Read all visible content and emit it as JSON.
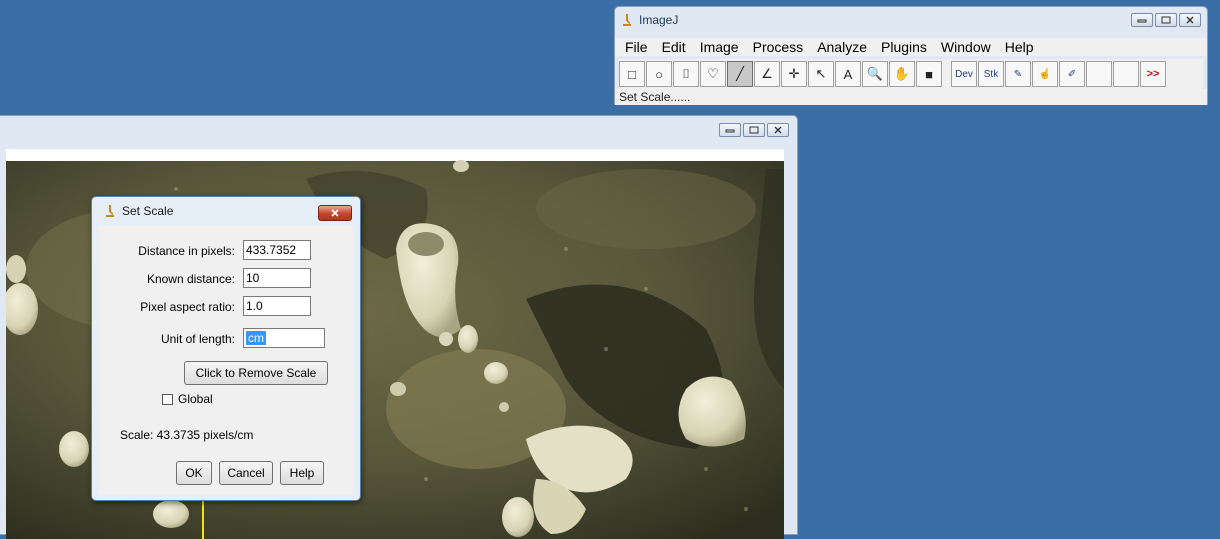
{
  "imagej": {
    "title": "ImageJ",
    "menus": [
      "File",
      "Edit",
      "Image",
      "Process",
      "Analyze",
      "Plugins",
      "Window",
      "Help"
    ],
    "tools": [
      {
        "name": "rectangle-tool-icon",
        "glyph": "□"
      },
      {
        "name": "oval-tool-icon",
        "glyph": "○"
      },
      {
        "name": "polygon-tool-icon",
        "glyph": "⌷"
      },
      {
        "name": "freehand-tool-icon",
        "glyph": "♡"
      },
      {
        "name": "line-tool-icon",
        "glyph": "╱",
        "active": true
      },
      {
        "name": "angle-tool-icon",
        "glyph": "∠"
      },
      {
        "name": "point-tool-icon",
        "glyph": "✛"
      },
      {
        "name": "wand-tool-icon",
        "glyph": "↖"
      },
      {
        "name": "text-tool-icon",
        "glyph": "A"
      },
      {
        "name": "magnifier-tool-icon",
        "glyph": "🔍"
      },
      {
        "name": "hand-tool-icon",
        "glyph": "✋"
      },
      {
        "name": "color-picker-tool-icon",
        "glyph": "■"
      }
    ],
    "tools2": [
      {
        "name": "dev-tool",
        "text": "Dev"
      },
      {
        "name": "stk-tool",
        "text": "Stk"
      },
      {
        "name": "brush-tool-icon",
        "text": "✎"
      },
      {
        "name": "pan-tool-icon",
        "text": "☝"
      },
      {
        "name": "pencil-tool-icon",
        "text": "✐"
      },
      {
        "name": "empty-tool-1",
        "text": ""
      },
      {
        "name": "empty-tool-2",
        "text": ""
      },
      {
        "name": "more-tools",
        "text": ">>"
      }
    ],
    "status": "Set Scale......"
  },
  "dialog": {
    "title": "Set Scale",
    "distance_label": "Distance in pixels:",
    "distance_value": "433.7352",
    "known_label": "Known distance:",
    "known_value": "10",
    "aspect_label": "Pixel aspect ratio:",
    "aspect_value": "1.0",
    "unit_label": "Unit of length:",
    "unit_value": "cm",
    "remove_button": "Click to Remove Scale",
    "global_label": "Global",
    "global_checked": false,
    "scale_text": "Scale: 43.3735 pixels/cm",
    "ok_button": "OK",
    "cancel_button": "Cancel",
    "help_button": "Help"
  },
  "colors": {
    "desktop": "#3a6ea5",
    "window_frame": "#dfe8f3",
    "close_red": "#c7452d"
  }
}
